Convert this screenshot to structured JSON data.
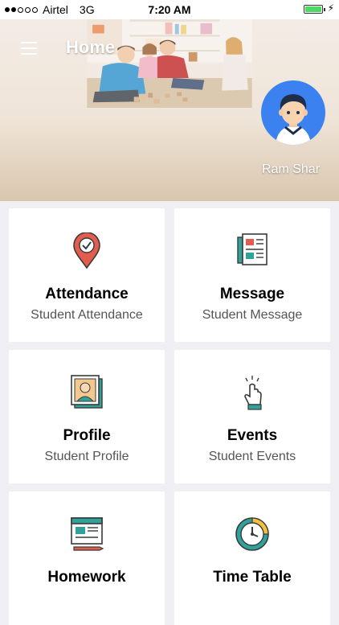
{
  "status_bar": {
    "carrier": "Airtel",
    "network": "3G",
    "time": "7:20 AM"
  },
  "header": {
    "title": "Home",
    "user_name": "Ram Shar"
  },
  "tiles": [
    {
      "title": "Attendance",
      "subtitle": "Student Attendance",
      "icon": "location-pin-check-icon"
    },
    {
      "title": "Message",
      "subtitle": "Student Message",
      "icon": "newspaper-icon"
    },
    {
      "title": "Profile",
      "subtitle": "Student Profile",
      "icon": "photo-id-icon"
    },
    {
      "title": "Events",
      "subtitle": "Student Events",
      "icon": "hand-tap-icon"
    },
    {
      "title": "Homework",
      "subtitle": "",
      "icon": "browser-document-icon"
    },
    {
      "title": "Time Table",
      "subtitle": "",
      "icon": "clock-icon"
    }
  ],
  "colors": {
    "accent_teal": "#2fa39a",
    "avatar_blue": "#3b82f0",
    "pin_red": "#e35d4f",
    "background": "#efeff4"
  }
}
